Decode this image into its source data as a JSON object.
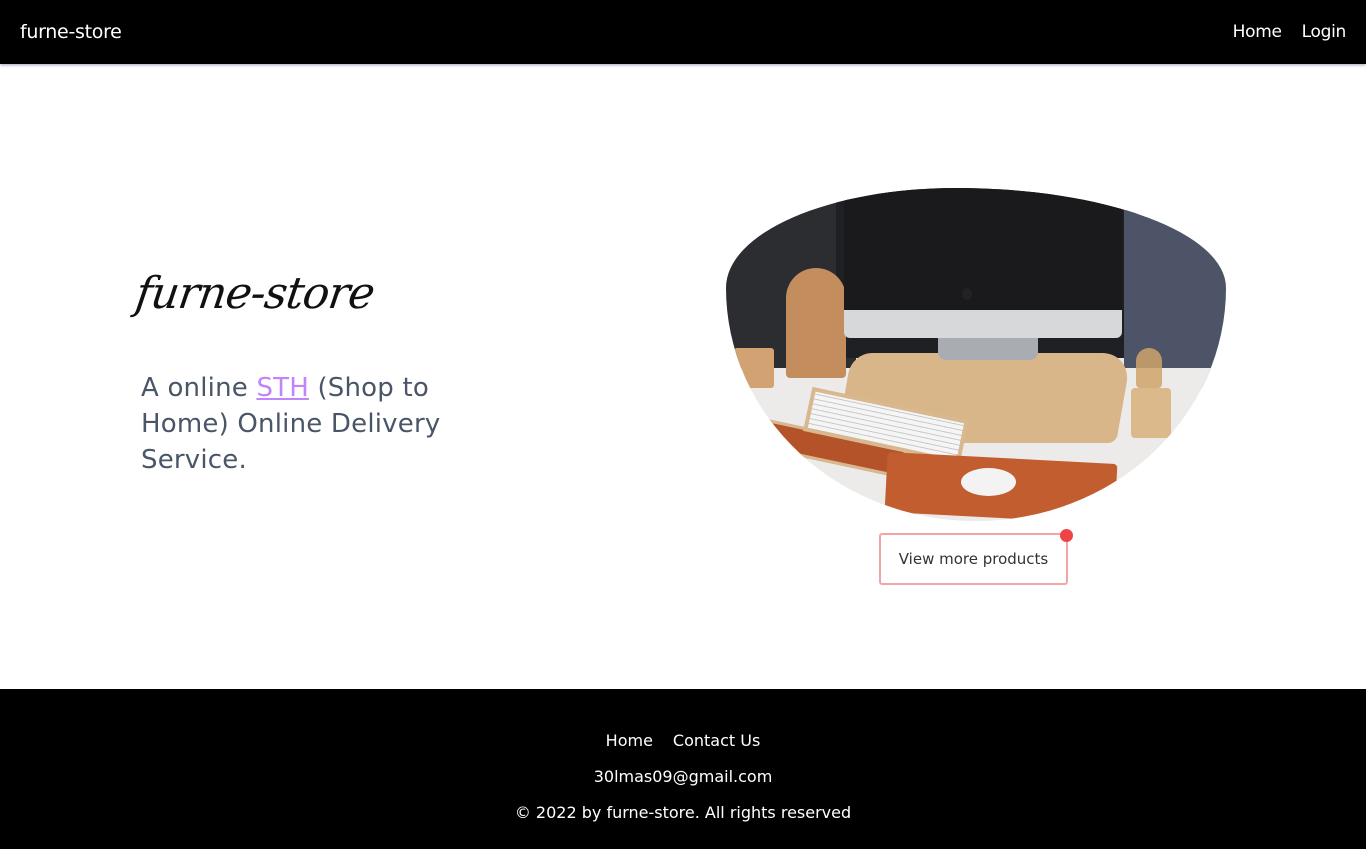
{
  "navbar": {
    "brand": "furne-store",
    "links": [
      {
        "label": "Home"
      },
      {
        "label": "Login"
      }
    ]
  },
  "hero": {
    "logo_text": "furne-store",
    "tagline": {
      "prefix": "A online ",
      "link_text": "STH",
      "suffix": " (Shop to Home) Online Delivery Service."
    },
    "image_alt": "desk setup with computer, keyboard and wooden accessories",
    "cta_label": "View more products"
  },
  "footer": {
    "links": [
      {
        "label": "Home"
      },
      {
        "label": "Contact Us"
      }
    ],
    "email": "30lmas09@gmail.com",
    "copyright": "© 2022 by furne-store. All rights reserved"
  },
  "colors": {
    "nav_bg": "#000000",
    "link_accent": "#c084fc",
    "tagline_text": "#4a5568",
    "cta_border": "#f4a4a4",
    "cta_dot": "#ef4444"
  }
}
